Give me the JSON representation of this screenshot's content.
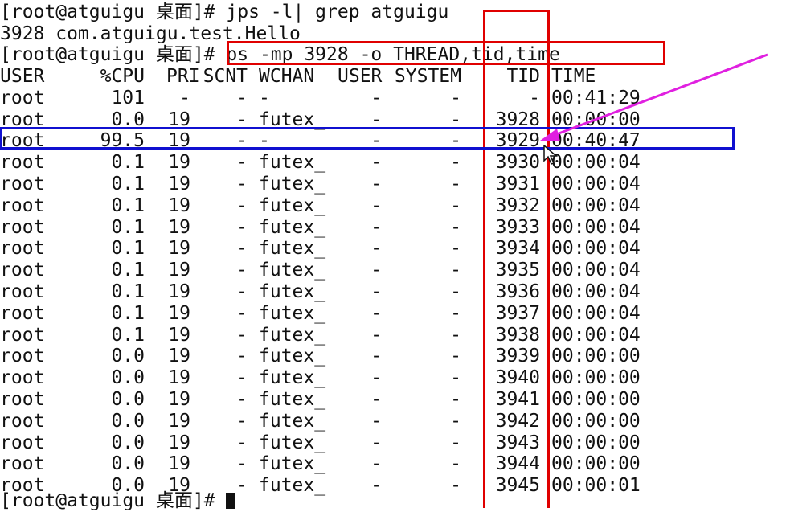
{
  "terminal": {
    "prompt1": "[root@atguigu 桌面]# ",
    "cmd1": "jps -l| grep atguigu",
    "out1": "3928 com.atguigu.test.Hello",
    "prompt2": "[root@atguigu 桌面]# ",
    "cmd2": "ps -mp 3928 -o THREAD,tid,time",
    "headers": [
      "USER",
      "%CPU",
      "PRI",
      "SCNT",
      "WCHAN",
      "USER",
      "SYSTEM",
      "TID",
      "TIME"
    ],
    "rows": [
      [
        "root",
        "101",
        "-",
        "-",
        "-",
        "-",
        "-",
        "-",
        "00:41:29"
      ],
      [
        "root",
        "0.0",
        "19",
        "-",
        "futex_",
        "-",
        "-",
        "3928",
        "00:00:00"
      ],
      [
        "root",
        "99.5",
        "19",
        "-",
        "-",
        "-",
        "-",
        "3929",
        "00:40:47"
      ],
      [
        "root",
        "0.1",
        "19",
        "-",
        "futex_",
        "-",
        "-",
        "3930",
        "00:00:04"
      ],
      [
        "root",
        "0.1",
        "19",
        "-",
        "futex_",
        "-",
        "-",
        "3931",
        "00:00:04"
      ],
      [
        "root",
        "0.1",
        "19",
        "-",
        "futex_",
        "-",
        "-",
        "3932",
        "00:00:04"
      ],
      [
        "root",
        "0.1",
        "19",
        "-",
        "futex_",
        "-",
        "-",
        "3933",
        "00:00:04"
      ],
      [
        "root",
        "0.1",
        "19",
        "-",
        "futex_",
        "-",
        "-",
        "3934",
        "00:00:04"
      ],
      [
        "root",
        "0.1",
        "19",
        "-",
        "futex_",
        "-",
        "-",
        "3935",
        "00:00:04"
      ],
      [
        "root",
        "0.1",
        "19",
        "-",
        "futex_",
        "-",
        "-",
        "3936",
        "00:00:04"
      ],
      [
        "root",
        "0.1",
        "19",
        "-",
        "futex_",
        "-",
        "-",
        "3937",
        "00:00:04"
      ],
      [
        "root",
        "0.1",
        "19",
        "-",
        "futex_",
        "-",
        "-",
        "3938",
        "00:00:04"
      ],
      [
        "root",
        "0.0",
        "19",
        "-",
        "futex_",
        "-",
        "-",
        "3939",
        "00:00:00"
      ],
      [
        "root",
        "0.0",
        "19",
        "-",
        "futex_",
        "-",
        "-",
        "3940",
        "00:00:00"
      ],
      [
        "root",
        "0.0",
        "19",
        "-",
        "futex_",
        "-",
        "-",
        "3941",
        "00:00:00"
      ],
      [
        "root",
        "0.0",
        "19",
        "-",
        "futex_",
        "-",
        "-",
        "3942",
        "00:00:00"
      ],
      [
        "root",
        "0.0",
        "19",
        "-",
        "futex_",
        "-",
        "-",
        "3943",
        "00:00:00"
      ],
      [
        "root",
        "0.0",
        "19",
        "-",
        "futex_",
        "-",
        "-",
        "3944",
        "00:00:00"
      ],
      [
        "root",
        "0.0",
        "19",
        "-",
        "futex_",
        "-",
        "-",
        "3945",
        "00:00:01"
      ]
    ],
    "prompt3": "[root@atguigu 桌面]# "
  },
  "annotations": {
    "command_box_color": "#e00000",
    "tid_column_box_color": "#e00000",
    "highlight_row_color": "#1010d0",
    "arrow_color": "#e020e0",
    "highlighted_row_index": 2,
    "mouse_cursor_icon": "arrow-pointer-icon"
  }
}
